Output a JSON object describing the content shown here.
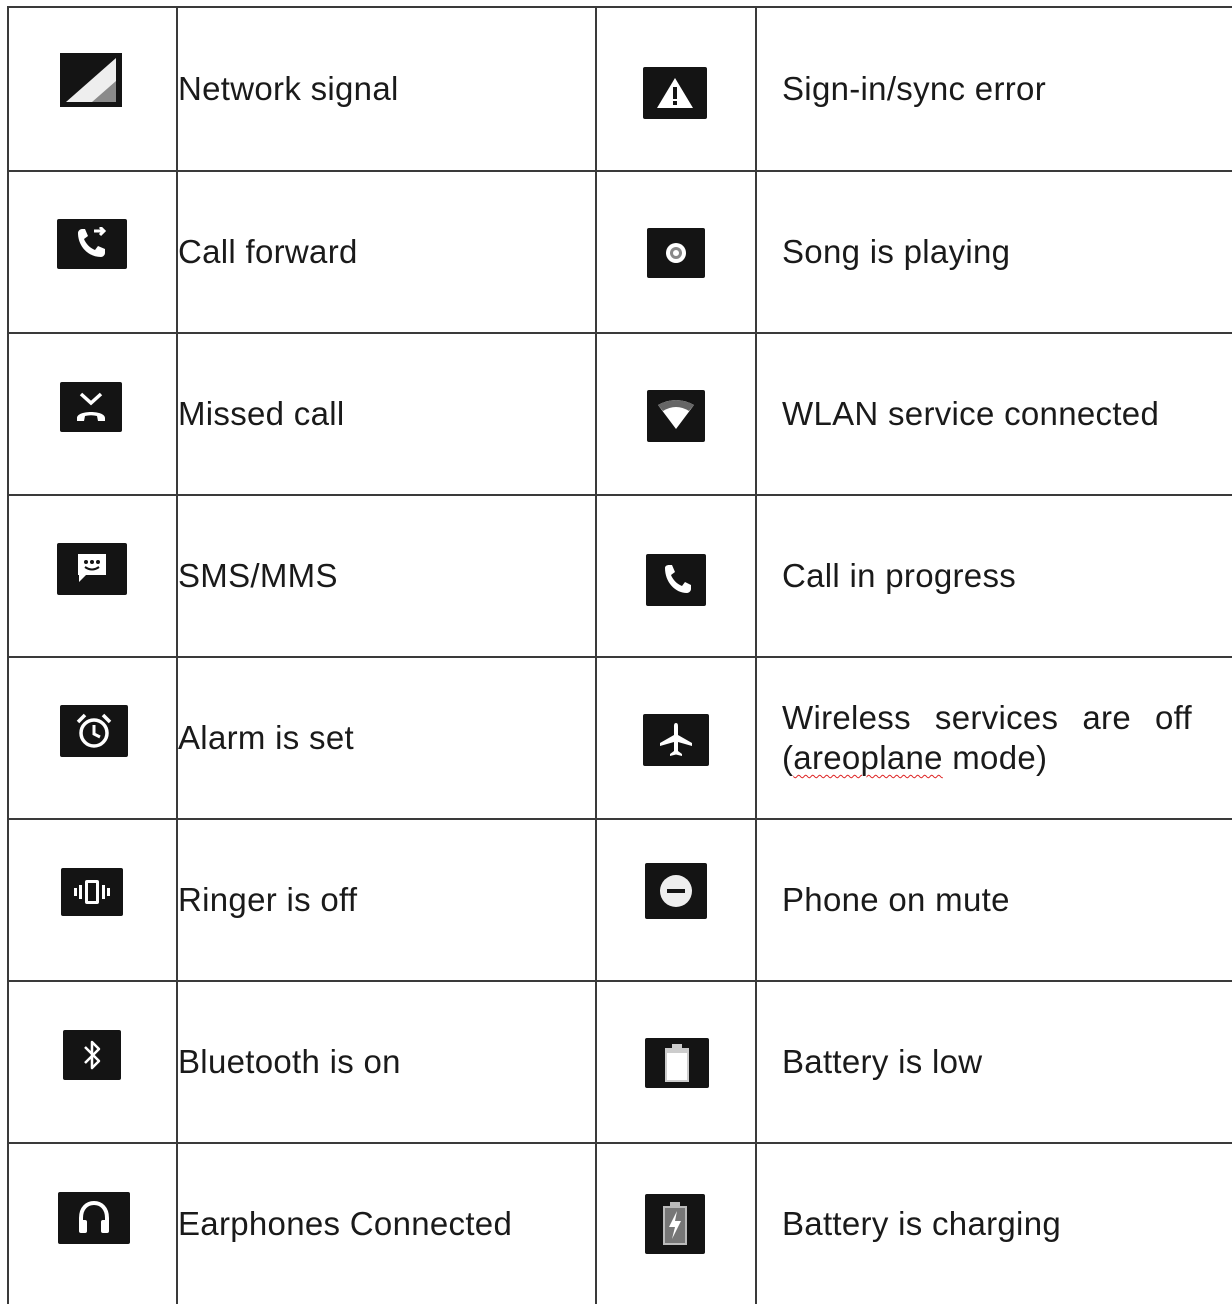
{
  "rows": [
    {
      "left": {
        "icon": "network-signal-icon",
        "label": "Network signal"
      },
      "right": {
        "icon": "sync-error-icon",
        "label": "Sign-in/sync error"
      }
    },
    {
      "left": {
        "icon": "call-forward-icon",
        "label": "Call forward"
      },
      "right": {
        "icon": "song-playing-icon",
        "label": "Song is playing"
      }
    },
    {
      "left": {
        "icon": "missed-call-icon",
        "label": "Missed call"
      },
      "right": {
        "icon": "wlan-icon",
        "label": "WLAN service connected"
      }
    },
    {
      "left": {
        "icon": "sms-icon",
        "label": "SMS/MMS"
      },
      "right": {
        "icon": "call-in-progress-icon",
        "label": "Call in progress"
      }
    },
    {
      "left": {
        "icon": "alarm-icon",
        "label": "Alarm is set"
      },
      "right": {
        "icon": "airplane-icon",
        "label_part1": "Wireless services are off (",
        "label_part2": "areoplane",
        "label_part3": " mode)"
      }
    },
    {
      "left": {
        "icon": "vibrate-icon",
        "label": "Ringer is off"
      },
      "right": {
        "icon": "mute-icon",
        "label": "Phone on mute"
      }
    },
    {
      "left": {
        "icon": "bluetooth-icon",
        "label": "Bluetooth is on"
      },
      "right": {
        "icon": "battery-low-icon",
        "label": "Battery is low"
      }
    },
    {
      "left": {
        "icon": "headphones-icon",
        "label": "Earphones Connected"
      },
      "right": {
        "icon": "battery-charging-icon",
        "label": "Battery is charging"
      }
    }
  ]
}
